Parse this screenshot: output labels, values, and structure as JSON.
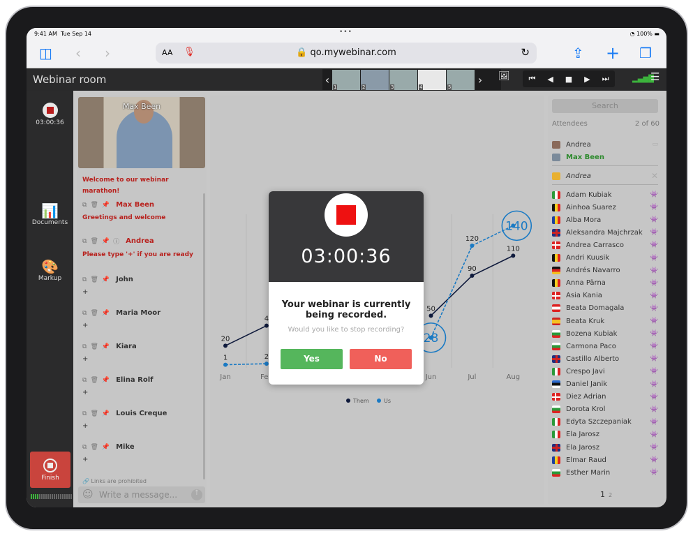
{
  "status_bar": {
    "time": "9:41 AM",
    "date": "Tue Sep 14",
    "battery": "100%"
  },
  "browser": {
    "text_size": "AA",
    "url": "qo.mywebinar.com"
  },
  "app": {
    "title": "Webinar room",
    "slides": [
      "1",
      "2",
      "3",
      "4",
      "5"
    ],
    "active_slide": 4,
    "signal_bars": 4
  },
  "left_bar": {
    "timer": "03:00:36",
    "documents": "Documents",
    "markup": "Markup",
    "finish": "Finish",
    "mic_level": 0.2
  },
  "video": {
    "name": "Max Been"
  },
  "chat": {
    "messages": [
      {
        "author": "",
        "text": "Welcome to our webinar marathon!",
        "highlight": true
      },
      {
        "author": "Max Been",
        "text": "Greetings and welcome",
        "highlight": true
      },
      {
        "author": "Andrea",
        "text": "Please type '+' if you are ready",
        "highlight": true
      },
      {
        "author": "John",
        "text": "+"
      },
      {
        "author": "Maria Moor",
        "text": "+"
      },
      {
        "author": "Kiara",
        "text": "+"
      },
      {
        "author": "Elina Rolf",
        "text": "+"
      },
      {
        "author": "Louis Creque",
        "text": "+"
      },
      {
        "author": "Mike",
        "text": "+"
      }
    ],
    "links_notice": "Links are prohibited",
    "placeholder": "Write a message..."
  },
  "chart_data": {
    "type": "line",
    "categories": [
      "Jan",
      "Feb",
      "Mar",
      "Apr",
      "May",
      "Jun",
      "Jul",
      "Aug"
    ],
    "series": [
      {
        "name": "Them",
        "values": [
          20,
          40,
          null,
          null,
          null,
          50,
          90,
          110
        ],
        "color": "#0f1a3c"
      },
      {
        "name": "Us",
        "values": [
          1,
          2,
          null,
          null,
          null,
          28,
          120,
          140
        ],
        "color": "#1a7ac4"
      }
    ],
    "data_labels": {
      "Them": [
        "20",
        "4",
        "",
        "",
        "",
        "50",
        "90",
        "110"
      ],
      "Us": [
        "1",
        "2",
        "",
        "",
        "",
        "28",
        "120",
        "140"
      ]
    },
    "legend": "bottom"
  },
  "modal": {
    "timer": "03:00:36",
    "question": "Your webinar is currently being recorded.",
    "sub": "Would you like to stop recording?",
    "yes": "Yes",
    "no": "No",
    "yes_color": "#55b65c",
    "no_color": "#f0605a"
  },
  "attendees": {
    "search": "Search",
    "label": "Attendees",
    "count": "2 of 60",
    "presenters": [
      {
        "name": "Andrea"
      },
      {
        "name": "Max Been"
      }
    ],
    "invited": "Andrea",
    "list": [
      {
        "name": "Adam Kubiak",
        "flag": "it"
      },
      {
        "name": "Ainhoa Suarez",
        "flag": "be"
      },
      {
        "name": "Alba Mora",
        "flag": "ad"
      },
      {
        "name": "Aleksandra Majchrzak",
        "flag": "gb"
      },
      {
        "name": "Andrea Carrasco",
        "flag": "dk"
      },
      {
        "name": "Andri Kuusik",
        "flag": "be"
      },
      {
        "name": "Andrés Navarro",
        "flag": "de"
      },
      {
        "name": "Anna Pärna",
        "flag": "be"
      },
      {
        "name": "Asia Kania",
        "flag": "dk"
      },
      {
        "name": "Beata Domagala",
        "flag": "at"
      },
      {
        "name": "Beata Kruk",
        "flag": "es"
      },
      {
        "name": "Bozena Kubiak",
        "flag": "bg"
      },
      {
        "name": "Carmona Paco",
        "flag": "bg"
      },
      {
        "name": "Castillo Alberto",
        "flag": "gb"
      },
      {
        "name": "Crespo Javi",
        "flag": "it"
      },
      {
        "name": "Daniel Janik",
        "flag": "ee"
      },
      {
        "name": "Diez Adrian",
        "flag": "dk"
      },
      {
        "name": "Dorota Krol",
        "flag": "bg"
      },
      {
        "name": "Edyta Szczepaniak",
        "flag": "it"
      },
      {
        "name": "Ela Jarosz",
        "flag": "it"
      },
      {
        "name": "Ela Jarosz",
        "flag": "gb"
      },
      {
        "name": "Elmar Raud",
        "flag": "ad"
      },
      {
        "name": "Esther Marin",
        "flag": "bg"
      }
    ],
    "pages": [
      "1",
      "2"
    ]
  }
}
